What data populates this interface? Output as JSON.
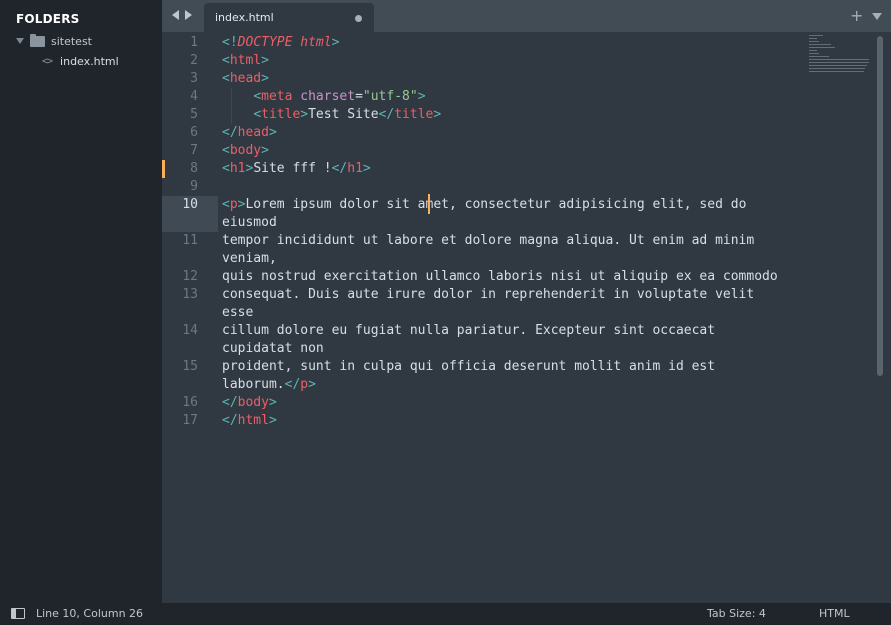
{
  "sidebar": {
    "header": "FOLDERS",
    "folder": {
      "name": "sitetest",
      "icon": "folder-icon",
      "expand_icon": "triangle-down-icon"
    },
    "file": {
      "name": "index.html",
      "icon": "code-icon"
    }
  },
  "tabs": {
    "active": {
      "label": "index.html",
      "modified": true
    }
  },
  "editor": {
    "active_line": 10,
    "line_numbers": [
      "1",
      "2",
      "3",
      "4",
      "5",
      "6",
      "7",
      "8",
      "9",
      "10",
      "",
      "11",
      "",
      "12",
      "13",
      "",
      "14",
      "",
      "15",
      "",
      "16",
      "17"
    ],
    "code": {
      "l1_open": "<!",
      "l1_kw": "DOCTYPE",
      "l1_kw2": "html",
      "l1_close": ">",
      "l2": "html",
      "l3": "head",
      "l4_tag": "meta",
      "l4_attr": "charset",
      "l4_eq": "=",
      "l4_val": "\"utf-8\"",
      "l5_tag": "title",
      "l5_text": "Test Site",
      "l6_tag": "head",
      "l7_tag": "body",
      "l8_tag": "h1",
      "l8_text": "Site fff !",
      "l10_tag": "p",
      "l10_text": "Lorem ipsum dolor sit amet, consectetur adipisicing elit, sed do",
      "l10_wrap": "eiusmod",
      "l11": "tempor incididunt ut labore et dolore magna aliqua. Ut enim ad minim",
      "l11_wrap": "veniam,",
      "l12": "quis nostrud exercitation ullamco laboris nisi ut aliquip ex ea commodo",
      "l13": "consequat. Duis aute irure dolor in reprehenderit in voluptate velit",
      "l13_wrap": "esse",
      "l14": "cillum dolore eu fugiat nulla pariatur. Excepteur sint occaecat",
      "l14_wrap": "cupidatat non",
      "l15": "proident, sunt in culpa qui officia deserunt mollit anim id est",
      "l15_wrap": "laborum.",
      "l15_tag": "p",
      "l16_tag": "body",
      "l17_tag": "html"
    }
  },
  "status": {
    "position": "Line 10, Column 26",
    "tab_size": "Tab Size: 4",
    "syntax": "HTML"
  },
  "colors": {
    "background": "#303841",
    "sidebar": "#1f252b",
    "tag": "#ec5f66",
    "bracket": "#5fb4b4",
    "attribute": "#c695c6",
    "string": "#99c794",
    "cursor": "#f9ae58"
  }
}
